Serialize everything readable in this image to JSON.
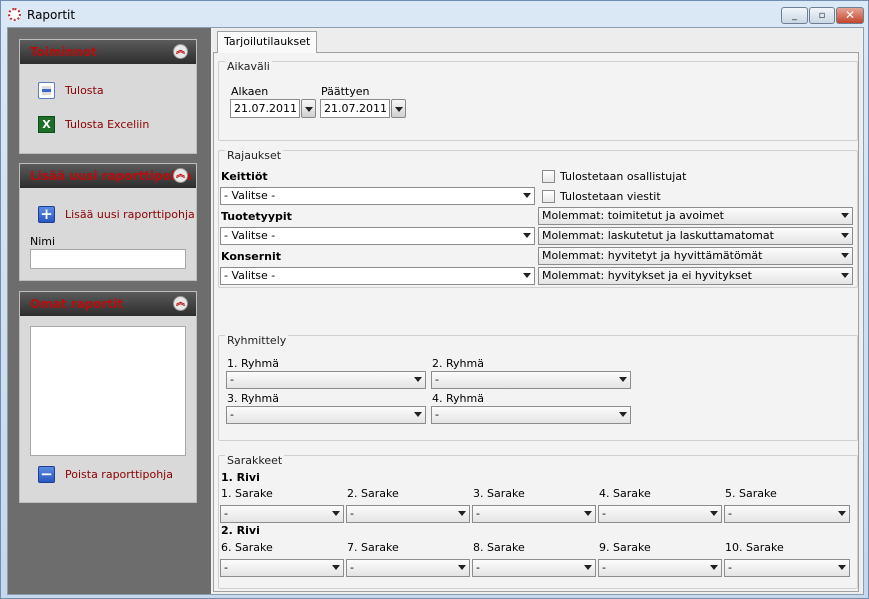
{
  "window": {
    "title": "Raportit",
    "minimize": "_",
    "maximize": "▫",
    "close": "✕"
  },
  "sidebar": {
    "actions": {
      "title": "Toiminnot",
      "print": "Tulosta",
      "print_excel": "Tulosta Exceliin"
    },
    "add_template": {
      "title": "Lisää uusi raporttipohja",
      "add": "Lisää uusi raporttipohja",
      "name_label": "Nimi",
      "name_value": ""
    },
    "own_reports": {
      "title": "Omat raportit",
      "remove": "Poista raporttipohja"
    }
  },
  "tab": {
    "label": "Tarjoilutilaukset"
  },
  "period": {
    "title": "Aikaväli",
    "start_label": "Alkaen",
    "start_value": "21.07.2011",
    "end_label": "Päättyen",
    "end_value": "21.07.2011"
  },
  "filters": {
    "title": "Rajaukset",
    "kitchens_label": "Keittiöt",
    "kitchens_value": "- Valitse -",
    "product_types_label": "Tuotetyypit",
    "product_types_value": "- Valitse -",
    "groups_label": "Konsernit",
    "groups_value": "- Valitse -",
    "print_participants": "Tulostetaan osallistujat",
    "print_messages": "Tulostetaan viestit",
    "options": [
      "Molemmat: toimitetut ja avoimet",
      "Molemmat: laskutetut ja laskuttamatomat",
      "Molemmat: hyvitetyt ja hyvittämätömät",
      "Molemmat: hyvitykset ja ei hyvitykset"
    ]
  },
  "grouping": {
    "title": "Ryhmittely",
    "g1": "1. Ryhmä",
    "g2": "2. Ryhmä",
    "g3": "3. Ryhmä",
    "g4": "4. Ryhmä",
    "empty": "-"
  },
  "columns": {
    "title": "Sarakkeet",
    "row1": "1. Rivi",
    "row2": "2. Rivi",
    "labels": [
      "1. Sarake",
      "2. Sarake",
      "3. Sarake",
      "4. Sarake",
      "5. Sarake",
      "6. Sarake",
      "7. Sarake",
      "8. Sarake",
      "9. Sarake",
      "10. Sarake"
    ],
    "empty": "-"
  }
}
